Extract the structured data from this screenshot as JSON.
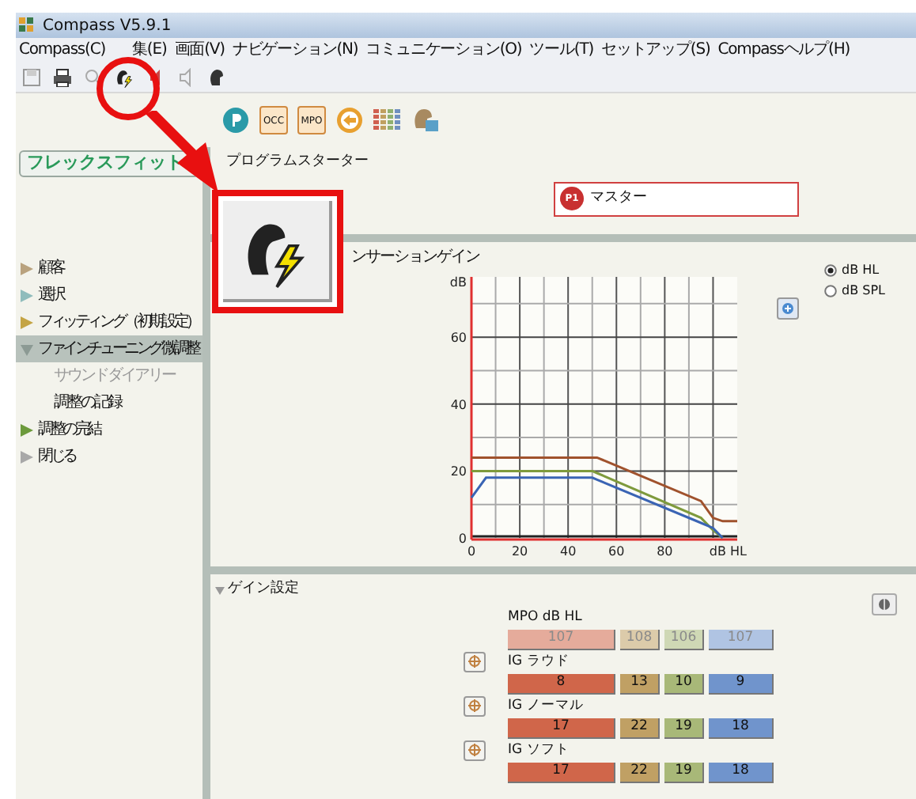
{
  "window": {
    "title": "Compass V5.9.1"
  },
  "menu": [
    "Compass(C)",
    "集(E)",
    "画面(V)",
    "ナビゲーション(N)",
    "コミュニケーション(O)",
    "ツール(T)",
    "セットアップ(S)",
    "Compassヘルプ(H)"
  ],
  "toolbar2": {
    "occ_label": "OCC",
    "mpo_label": "MPO"
  },
  "sidebar": {
    "header": "フレックスフィット",
    "items": [
      {
        "label": "顧客",
        "color": "#b9a27e",
        "selected": false,
        "expanded": false
      },
      {
        "label": "選択",
        "color": "#8fbcbc",
        "selected": false,
        "expanded": false
      },
      {
        "label": "フィッティング（初期設定）",
        "color": "#c4a444",
        "selected": false,
        "expanded": false
      },
      {
        "label": "ファインチューニング微調整",
        "color": "#8c9a94",
        "selected": true,
        "expanded": true,
        "children": [
          {
            "label": "サウンドダイアリー",
            "disabled": true
          },
          {
            "label": "調整の記録",
            "disabled": false
          }
        ]
      },
      {
        "label": "調整の完結",
        "color": "#6c9a3c",
        "selected": false,
        "expanded": false
      },
      {
        "label": "閉じる",
        "color": "#a8a8a8",
        "selected": false,
        "expanded": false
      }
    ]
  },
  "program_starter": {
    "title": "プログラムスターター",
    "program": {
      "badge": "P1",
      "label": "マスター"
    }
  },
  "insertion_gain": {
    "title": "ンサーションゲイン",
    "chart_data": {
      "type": "line",
      "grid": true,
      "xlabel": "dB HL",
      "ylabel": "dB",
      "x": [
        0,
        6,
        50,
        52,
        95,
        100,
        104,
        110
      ],
      "xlim": [
        0,
        110
      ],
      "ylim": [
        0,
        78
      ],
      "xticks": [
        0,
        20,
        40,
        60,
        80
      ],
      "yticks": [
        0,
        20,
        40,
        60
      ],
      "series": [
        {
          "color": "#a0522d",
          "values": [
            24,
            24,
            24,
            24,
            11,
            6,
            5,
            5
          ]
        },
        {
          "color": "#7e9a3c",
          "values": [
            20,
            20,
            20,
            19.4,
            6,
            2.3,
            0,
            null
          ]
        },
        {
          "color": "#3a64b4",
          "values": [
            12,
            18,
            18,
            17.4,
            4.5,
            3,
            0,
            null
          ]
        }
      ]
    },
    "units": [
      {
        "label": "dB HL",
        "selected": true
      },
      {
        "label": "dB SPL",
        "selected": false
      }
    ]
  },
  "gain_settings": {
    "title": "ゲイン設定",
    "expanded": true,
    "columns": [
      {
        "color": "#d0664a"
      },
      {
        "color": "#c0a064"
      },
      {
        "color": "#a8b878"
      },
      {
        "color": "#7094cc"
      }
    ],
    "rows": [
      {
        "kind": "mpo",
        "label": "MPO dB HL",
        "disabled": true,
        "values": [
          "107",
          "108",
          "106",
          "107"
        ]
      },
      {
        "kind": "ig",
        "label": "IG ラウド",
        "disabled": false,
        "values": [
          "8",
          "13",
          "10",
          "9"
        ]
      },
      {
        "kind": "ig",
        "label": "IG ノーマル",
        "disabled": false,
        "values": [
          "17",
          "22",
          "19",
          "18"
        ]
      },
      {
        "kind": "ig",
        "label": "IG ソフト",
        "disabled": false,
        "values": [
          "17",
          "22",
          "19",
          "18"
        ]
      }
    ]
  }
}
